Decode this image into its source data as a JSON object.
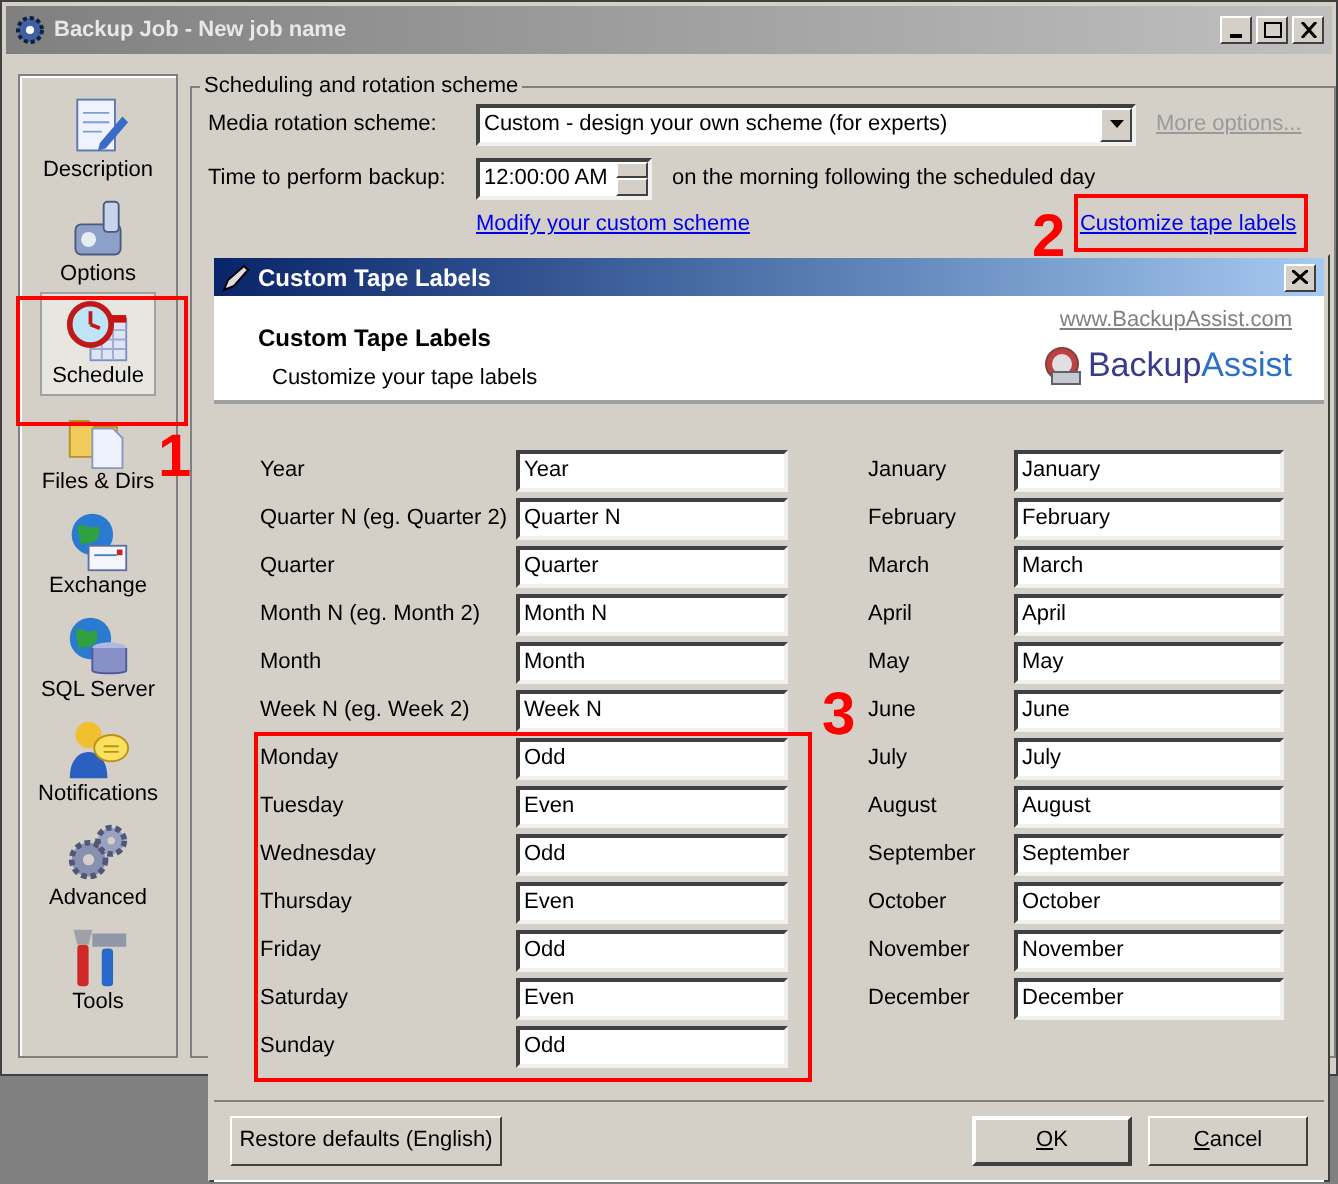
{
  "window": {
    "title": "Backup Job - New job name"
  },
  "sidebar": {
    "items": [
      {
        "label": "Description",
        "selected": false
      },
      {
        "label": "Options",
        "selected": false
      },
      {
        "label": "Schedule",
        "selected": true
      },
      {
        "label": "Files & Dirs",
        "selected": false
      },
      {
        "label": "Exchange",
        "selected": false
      },
      {
        "label": "SQL Server",
        "selected": false
      },
      {
        "label": "Notifications",
        "selected": false
      },
      {
        "label": "Advanced",
        "selected": false
      },
      {
        "label": "Tools",
        "selected": false
      }
    ]
  },
  "scheduling": {
    "group_title": "Scheduling and rotation scheme",
    "media_label": "Media rotation scheme:",
    "media_value": "Custom - design your own scheme (for experts)",
    "more_options": {
      "label": "More options...",
      "disabled": true
    },
    "time_label": "Time to perform backup:",
    "time_value": "12:00:00 AM",
    "time_note": "on the morning following the scheduled day",
    "modify_link": "Modify your custom scheme",
    "customize_link": "Customize tape labels"
  },
  "dialog": {
    "title": "Custom Tape Labels",
    "heading": "Custom Tape Labels",
    "subheading": "Customize your tape labels",
    "website": "www.BackupAssist.com",
    "logo": {
      "part_1": "Backup",
      "part_2": "Assist"
    },
    "left_fields": [
      {
        "label": "Year",
        "value": "Year"
      },
      {
        "label": "Quarter N (eg. Quarter 2)",
        "value": "Quarter N"
      },
      {
        "label": "Quarter",
        "value": "Quarter"
      },
      {
        "label": "Month N (eg. Month 2)",
        "value": "Month N"
      },
      {
        "label": "Month",
        "value": "Month"
      },
      {
        "label": "Week N (eg. Week 2)",
        "value": "Week N"
      },
      {
        "label": "Monday",
        "value": "Odd"
      },
      {
        "label": "Tuesday",
        "value": "Even"
      },
      {
        "label": "Wednesday",
        "value": "Odd"
      },
      {
        "label": "Thursday",
        "value": "Even"
      },
      {
        "label": "Friday",
        "value": "Odd"
      },
      {
        "label": "Saturday",
        "value": "Even"
      },
      {
        "label": "Sunday",
        "value": "Odd"
      }
    ],
    "right_fields": [
      {
        "label": "January",
        "value": "January"
      },
      {
        "label": "February",
        "value": "February"
      },
      {
        "label": "March",
        "value": "March"
      },
      {
        "label": "April",
        "value": "April"
      },
      {
        "label": "May",
        "value": "May"
      },
      {
        "label": "June",
        "value": "June"
      },
      {
        "label": "July",
        "value": "July"
      },
      {
        "label": "August",
        "value": "August"
      },
      {
        "label": "September",
        "value": "September"
      },
      {
        "label": "October",
        "value": "October"
      },
      {
        "label": "November",
        "value": "November"
      },
      {
        "label": "December",
        "value": "December"
      }
    ],
    "buttons": {
      "restore": "Restore defaults (English)",
      "ok": "OK",
      "cancel": "Cancel"
    }
  },
  "annotations": [
    {
      "number": "1"
    },
    {
      "number": "2"
    },
    {
      "number": "3"
    }
  ]
}
